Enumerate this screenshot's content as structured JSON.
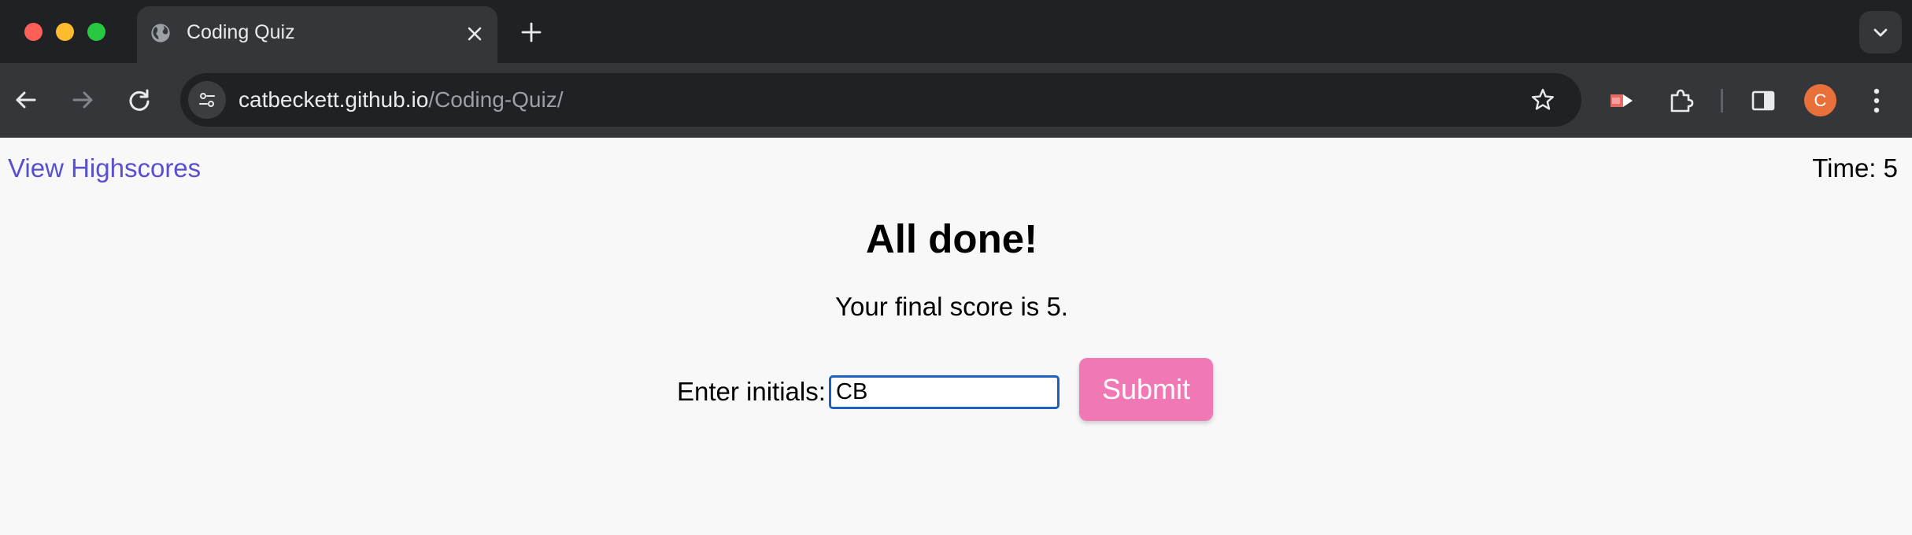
{
  "browser": {
    "tab": {
      "title": "Coding Quiz",
      "icon": "globe-icon"
    },
    "address": {
      "host": "catbeckett.github.io",
      "path": "/Coding-Quiz/"
    },
    "profile_initial": "C",
    "colors": {
      "tabstrip": "#202124",
      "toolbar": "#35363a",
      "avatar": "#e8703a"
    }
  },
  "quiz": {
    "highscores_link": "View Highscores",
    "timer": "Time: 5",
    "title": "All done!",
    "final_score": "Your final score is 5.",
    "initials_label": "Enter initials:",
    "initials_value": "CB",
    "submit_label": "Submit",
    "colors": {
      "link": "#5a4fcf",
      "submit": "#ef78b5",
      "input_border": "#1f5fbf"
    }
  }
}
